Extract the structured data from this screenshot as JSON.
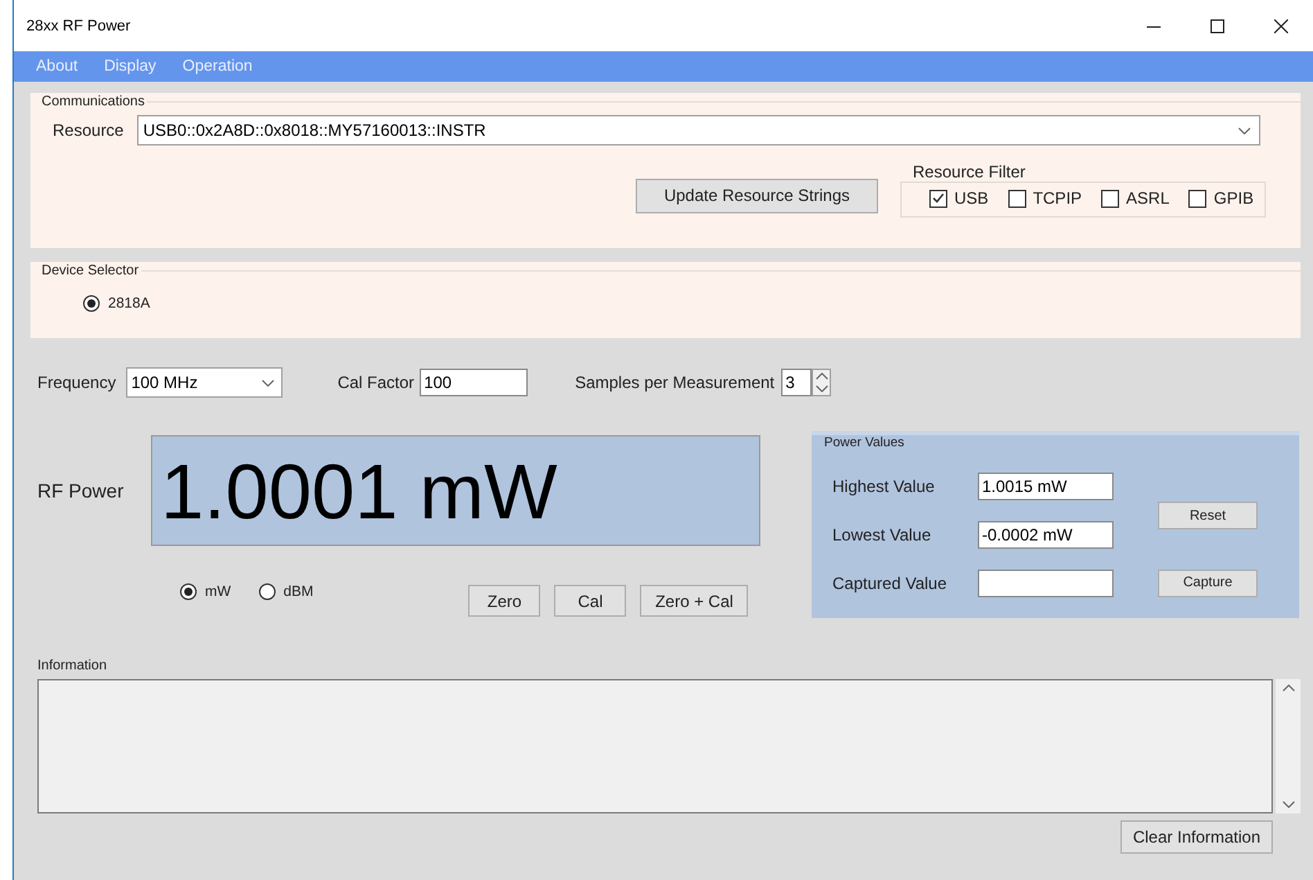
{
  "window": {
    "title": "28xx RF Power"
  },
  "menu": [
    "About",
    "Display",
    "Operation"
  ],
  "communications": {
    "title": "Communications",
    "resource_label": "Resource",
    "resource_value": "USB0::0x2A8D::0x8018::MY57160013::INSTR",
    "update_button": "Update Resource Strings",
    "filter": {
      "title": "Resource Filter",
      "options": [
        {
          "label": "USB",
          "checked": true
        },
        {
          "label": "TCPIP",
          "checked": false
        },
        {
          "label": "ASRL",
          "checked": false
        },
        {
          "label": "GPIB",
          "checked": false
        }
      ]
    }
  },
  "device_selector": {
    "title": "Device Selector",
    "devices": [
      {
        "label": "2818A",
        "selected": true
      }
    ]
  },
  "settings": {
    "frequency_label": "Frequency",
    "frequency_value": "100 MHz",
    "cal_factor_label": "Cal Factor",
    "cal_factor_value": "100",
    "samples_label": "Samples per Measurement",
    "samples_value": "3"
  },
  "rf_power": {
    "label": "RF Power",
    "reading": "1.0001 mW",
    "units": [
      {
        "label": "mW",
        "selected": true
      },
      {
        "label": "dBM",
        "selected": false
      }
    ],
    "buttons": [
      "Zero",
      "Cal",
      "Zero + Cal"
    ]
  },
  "power_values": {
    "title": "Power Values",
    "rows": [
      {
        "label": "Highest Value",
        "value": "1.0015 mW"
      },
      {
        "label": "Lowest Value",
        "value": "-0.0002 mW"
      },
      {
        "label": "Captured Value",
        "value": ""
      }
    ],
    "buttons": [
      "Reset",
      "Capture"
    ]
  },
  "information": {
    "title": "Information",
    "button": "Clear Information"
  }
}
